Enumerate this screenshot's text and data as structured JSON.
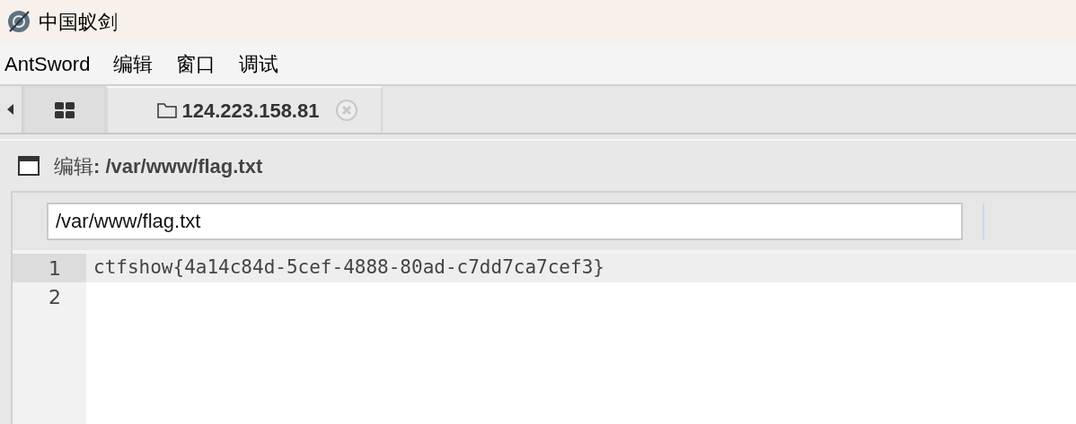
{
  "window": {
    "title": "中国蚁剑"
  },
  "menu": [
    "AntSword",
    "编辑",
    "窗口",
    "调试"
  ],
  "tabs": [
    {
      "kind": "home",
      "selected": false
    },
    {
      "kind": "host",
      "label": "124.223.158.81",
      "selected": true
    }
  ],
  "panel": {
    "title": "编辑**: /var/www/flag.txt**"
  },
  "editor": {
    "path": "/var/www/flag.txt",
    "lines": [
      {
        "number": "1",
        "text": "ctfshow{4a14c84d-5cef-4888-80ad-c7dd7ca7cef3}",
        "active": true
      },
      {
        "number": "2",
        "active": false
      }
    ]
  }
}
